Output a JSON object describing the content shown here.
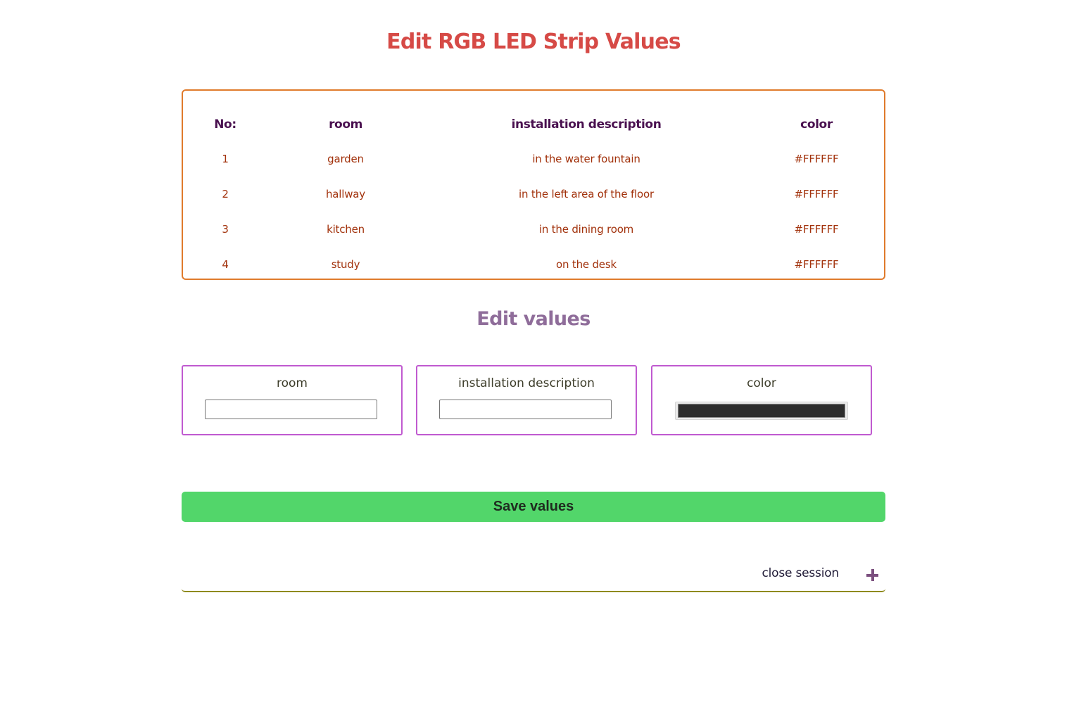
{
  "colors": {
    "title": "#d64a46",
    "table_border": "#e07b2c",
    "table_header": "#4a1150",
    "table_cell": "#a2320c",
    "section_title": "#8f6d9a",
    "field_border": "#c05ad0",
    "field_label": "#3d3d2a",
    "color_value": "#2d2d2d",
    "save_button_bg": "#52d66a",
    "save_button_text": "#1f2b1f",
    "session_text": "#1f1a36",
    "session_border": "#8f8a1e",
    "plus_icon": "#7b4f7e"
  },
  "header": {
    "title": "Edit RGB LED Strip Values"
  },
  "table": {
    "columns": [
      "No:",
      "room",
      "installation description",
      "color"
    ],
    "rows": [
      {
        "no": "1",
        "room": "garden",
        "description": "in the water fountain",
        "color": "#FFFFFF"
      },
      {
        "no": "2",
        "room": "hallway",
        "description": "in the left area of the floor",
        "color": "#FFFFFF"
      },
      {
        "no": "3",
        "room": "kitchen",
        "description": "in the dining room",
        "color": "#FFFFFF"
      },
      {
        "no": "4",
        "room": "study",
        "description": "on the desk",
        "color": "#FFFFFF"
      }
    ]
  },
  "edit": {
    "title": "Edit values",
    "fields": [
      {
        "label": "room",
        "value": "",
        "placeholder": ""
      },
      {
        "label": "installation description",
        "value": "",
        "placeholder": ""
      },
      {
        "label": "color",
        "value": "#2d2d2d"
      }
    ],
    "save_label": "Save values"
  },
  "session": {
    "label": "close session",
    "icon": "plus-icon"
  }
}
